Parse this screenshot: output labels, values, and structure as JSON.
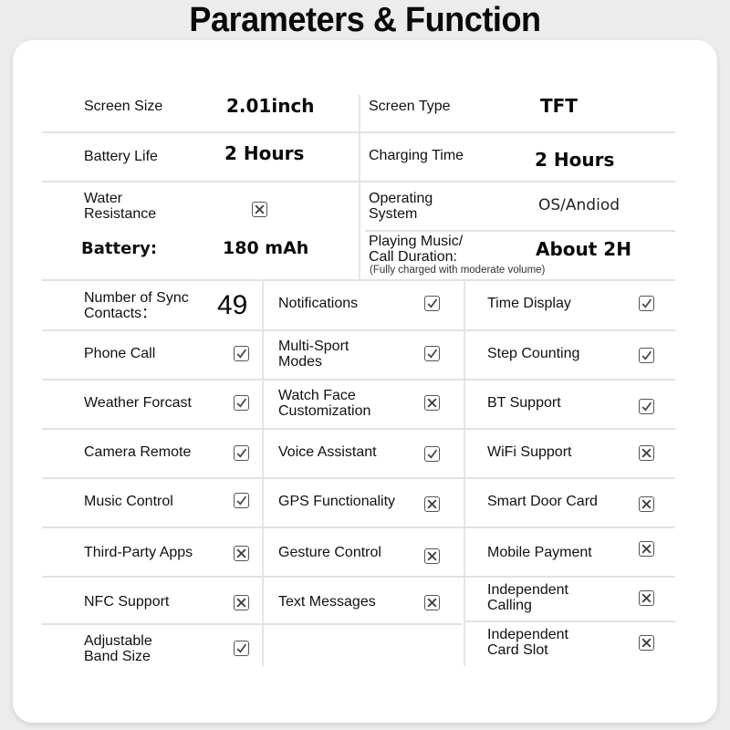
{
  "title": "Parameters & Function",
  "params": {
    "screen_size": {
      "label": "Screen Size",
      "value": "2.01inch"
    },
    "screen_type": {
      "label": "Screen Type",
      "value": "TFT"
    },
    "battery_life": {
      "label": "Battery Life",
      "value": "2 Hours"
    },
    "charging_time": {
      "label": "Charging Time",
      "value": "2 Hours"
    },
    "water_resistance": {
      "label_line1": "Water",
      "label_line2": "Resistance",
      "supported": false
    },
    "operating_system": {
      "label_line1": "Operating",
      "label_line2": "System",
      "value": "OS/Andiod"
    },
    "battery": {
      "label": "Battery:",
      "value": "180 mAh"
    },
    "playing_music": {
      "label_line1": "Playing Music/",
      "label_line2": "Call Duration:",
      "value": "About 2H",
      "note": "(Fully charged with moderate volume)"
    },
    "sync_contacts": {
      "label_line1": "Number of Sync",
      "label_line2": "Contacts：",
      "value": "49"
    }
  },
  "features": {
    "col1": [
      {
        "label": "Phone Call",
        "supported": true
      },
      {
        "label": "Weather Forcast",
        "supported": true
      },
      {
        "label": "Camera Remote",
        "supported": true
      },
      {
        "label": "Music Control",
        "supported": true
      },
      {
        "label": "Third-Party Apps",
        "supported": false
      },
      {
        "label": "NFC Support",
        "supported": false
      },
      {
        "label_line1": "Adjustable",
        "label_line2": "Band Size",
        "supported": true
      }
    ],
    "col2": [
      {
        "label": "Notifications",
        "supported": true
      },
      {
        "label_line1": "Multi-Sport",
        "label_line2": "Modes",
        "supported": true
      },
      {
        "label_line1": "Watch Face",
        "label_line2": "Customization",
        "supported": false
      },
      {
        "label": "Voice Assistant",
        "supported": true
      },
      {
        "label": "GPS Functionality",
        "supported": false
      },
      {
        "label": "Gesture Control",
        "supported": false
      },
      {
        "label": "Text Messages",
        "supported": false
      }
    ],
    "col3": [
      {
        "label": "Time Display",
        "supported": true
      },
      {
        "label": "Step Counting",
        "supported": true
      },
      {
        "label": "BT Support",
        "supported": true
      },
      {
        "label": "WiFi Support",
        "supported": false
      },
      {
        "label": "Smart Door Card",
        "supported": false
      },
      {
        "label": "Mobile Payment",
        "supported": false
      },
      {
        "label_line1": "Independent",
        "label_line2": "Calling",
        "supported": false
      },
      {
        "label_line1": "Independent",
        "label_line2": "Card Slot",
        "supported": false
      }
    ]
  }
}
